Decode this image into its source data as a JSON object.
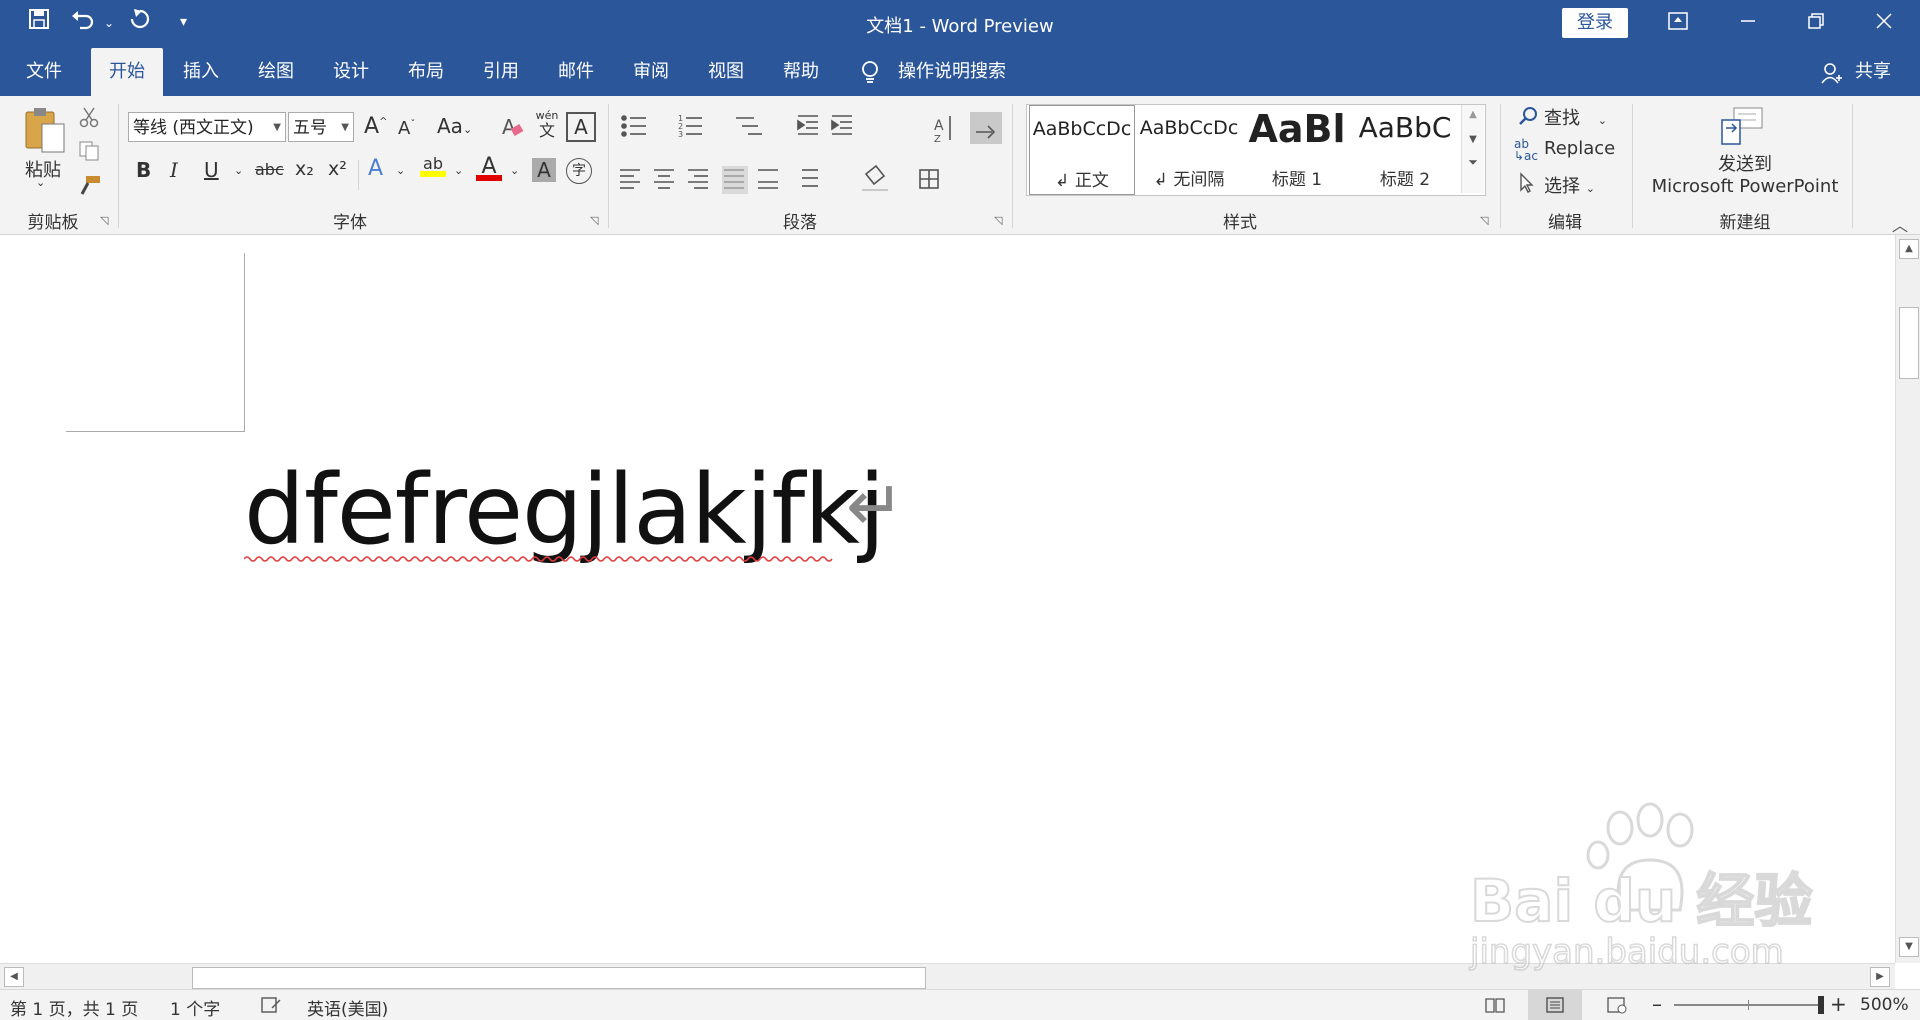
{
  "title_bar": {
    "document_title": "文档1  -  Word Preview",
    "login_label": "登录"
  },
  "tabs": [
    {
      "label": "文件"
    },
    {
      "label": "开始"
    },
    {
      "label": "插入"
    },
    {
      "label": "绘图"
    },
    {
      "label": "设计"
    },
    {
      "label": "布局"
    },
    {
      "label": "引用"
    },
    {
      "label": "邮件"
    },
    {
      "label": "审阅"
    },
    {
      "label": "视图"
    },
    {
      "label": "帮助"
    }
  ],
  "tell_me": "操作说明搜索",
  "share_label": "共享",
  "ribbon": {
    "clipboard": {
      "paste_label": "粘贴",
      "group_label": "剪贴板"
    },
    "font": {
      "font_name": "等线 (西文正文)",
      "font_size": "五号",
      "bold": "B",
      "italic": "I",
      "underline": "U",
      "strike": "abc",
      "sub": "x₂",
      "sup": "x²",
      "grow": "A",
      "shrink": "A",
      "case": "Aa",
      "pinyin_top": "wén",
      "pinyin_bottom": "文",
      "char_border": "A",
      "effects": "A",
      "highlight": "ab",
      "font_color": "A",
      "char_shade": "A",
      "enclose": "字",
      "group_label": "字体"
    },
    "paragraph": {
      "group_label": "段落"
    },
    "styles": {
      "items": [
        {
          "sample": "AaBbCcDc",
          "name": "↲ 正文"
        },
        {
          "sample": "AaBbCcDc",
          "name": "↲ 无间隔"
        },
        {
          "sample": "AaBl",
          "name": "标题 1"
        },
        {
          "sample": "AaBbC",
          "name": "标题 2"
        }
      ],
      "group_label": "样式"
    },
    "editing": {
      "find": "查找",
      "replace": "Replace",
      "select": "选择",
      "group_label": "编辑"
    },
    "new_group": {
      "send_line1": "发送到",
      "send_line2": "Microsoft PowerPoint",
      "group_label": "新建组"
    }
  },
  "document": {
    "text": "dfefregjlakjfkj",
    "paragraph_mark": "↵"
  },
  "status": {
    "page": "第 1 页，共 1 页",
    "words": "1 个字",
    "language": "英语(美国)",
    "zoom": "500%"
  },
  "watermark": {
    "brand": "Bai du 经验",
    "url": "jingyan.baidu.com"
  }
}
